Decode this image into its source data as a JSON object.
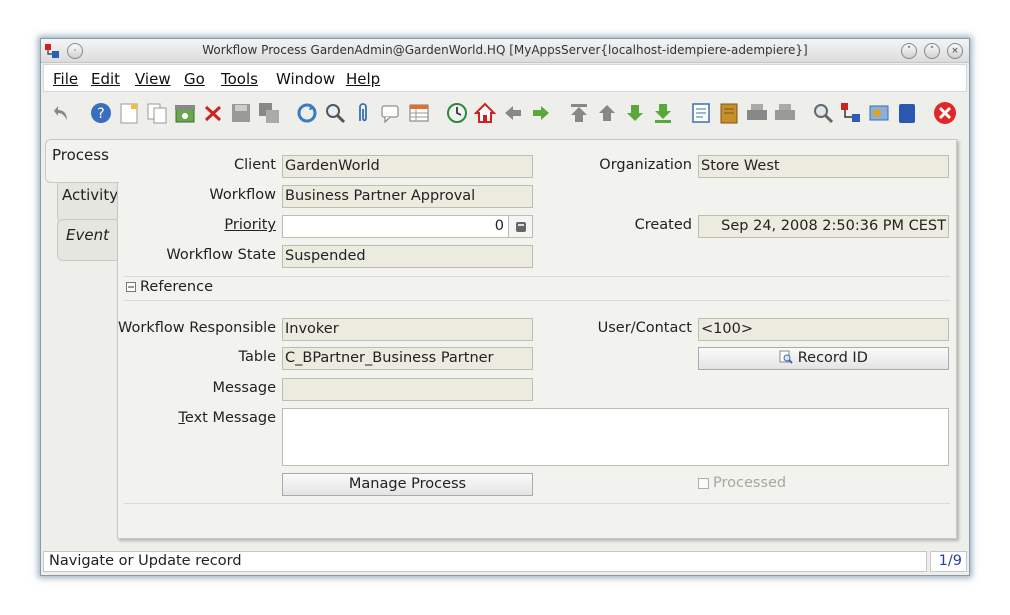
{
  "window": {
    "title": "Workflow Process  GardenAdmin@GardenWorld.HQ [MyAppsServer{localhost-idempiere-adempiere}]"
  },
  "menu": [
    "File",
    "Edit",
    "View",
    "Go",
    "Tools",
    "Window",
    "Help"
  ],
  "toolbar_icons": [
    "undo-icon",
    "help-icon",
    "new-record-icon",
    "copy-record-icon",
    "archive-icon",
    "delete-icon",
    "save-icon",
    "multi-record-icon",
    "refresh-icon",
    "find-icon",
    "attachment-icon",
    "chat-icon",
    "grid-toggle-icon",
    "history-icon",
    "home-icon",
    "back-icon",
    "forward-icon",
    "first-record-icon",
    "previous-record-icon",
    "next-record-icon",
    "last-record-icon",
    "report-icon",
    "archived-documents-icon",
    "print-icon",
    "print-preview-icon",
    "zoom-across-icon",
    "request-icon",
    "product-info-icon",
    "workflow-icon",
    "exit-icon"
  ],
  "tabs": [
    {
      "label": "Process",
      "active": true
    },
    {
      "label": "Activity",
      "active": false
    },
    {
      "label": "Event",
      "active": false
    }
  ],
  "form": {
    "client_label": "Client",
    "client_value": "GardenWorld",
    "org_label": "Organization",
    "org_value": "Store West",
    "workflow_label": "Workflow",
    "workflow_value": "Business Partner Approval",
    "priority_label": "Priority",
    "priority_value": "0",
    "created_label": "Created",
    "created_value": "Sep 24, 2008 2:50:36 PM CEST",
    "state_label": "Workflow State",
    "state_value": "Suspended",
    "reference_label": "Reference",
    "responsible_label": "Workflow Responsible",
    "responsible_value": "Invoker",
    "user_label": "User/Contact",
    "user_value": "<100>",
    "table_label": "Table",
    "table_value": "C_BPartner_Business Partner",
    "record_id_label": "Record ID",
    "message_label": "Message",
    "message_value": "",
    "text_message_label": "Text Message",
    "text_message_value": "",
    "manage_process_label": "Manage Process",
    "processed_label": "Processed"
  },
  "status": {
    "text": "Navigate or Update record",
    "record_count": "1/9"
  }
}
